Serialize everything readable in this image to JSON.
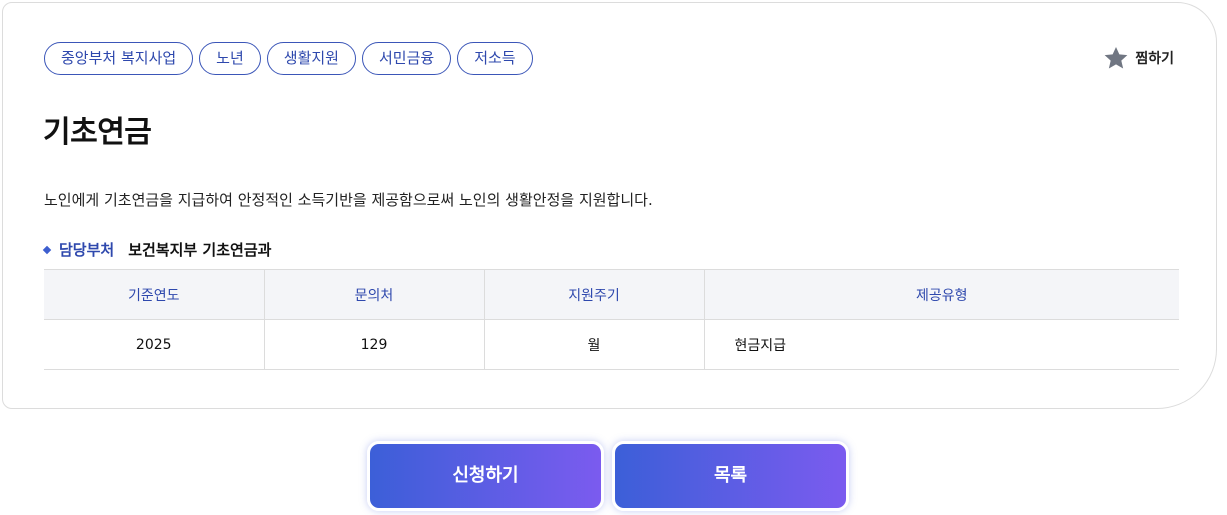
{
  "tags": [
    "중앙부처 복지사업",
    "노년",
    "생활지원",
    "서민금융",
    "저소득"
  ],
  "favorite": {
    "label": "찜하기",
    "icon": "star-icon"
  },
  "title": "기초연금",
  "description": "노인에게 기초연금을 지급하여 안정적인 소득기반을 제공함으로써 노인의 생활안정을 지원합니다.",
  "department": {
    "label": "담당부처",
    "value": "보건복지부 기초연금과"
  },
  "info_table": {
    "headers": [
      "기준연도",
      "문의처",
      "지원주기",
      "제공유형"
    ],
    "row": [
      "2025",
      "129",
      "월",
      "현금지급"
    ]
  },
  "buttons": {
    "apply": "신청하기",
    "list": "목록"
  },
  "colors": {
    "accent": "#2e48ad",
    "button_start": "#3c5fd8",
    "button_end": "#7b5bef",
    "star": "#707682"
  }
}
